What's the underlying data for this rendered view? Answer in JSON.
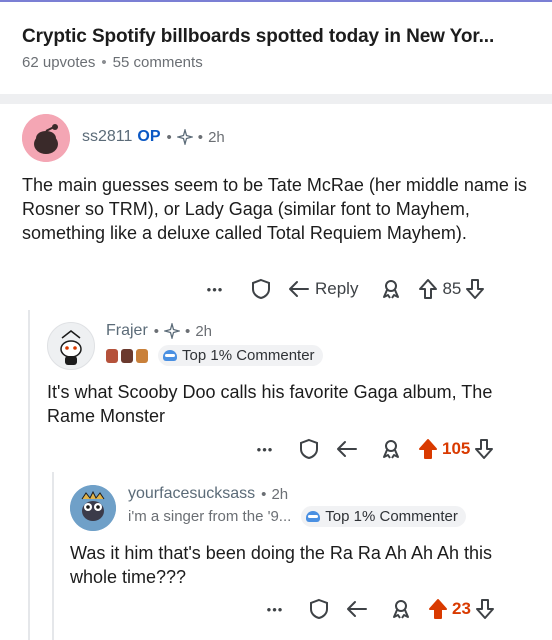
{
  "post": {
    "title": "Cryptic Spotify billboards spotted today in New Yor...",
    "upvotes": "62 upvotes",
    "comments": "55 comments",
    "separator": "•"
  },
  "comments": [
    {
      "username": "ss2811",
      "op_label": "OP",
      "separator": "•",
      "time": "2h",
      "body": "The main guesses seem to be Tate McRae (her middle name is Rosner so TRM), or Lady Gaga (similar font to Mayhem, something like a deluxe called Total Requiem Mayhem).",
      "more": "•••",
      "reply_label": "Reply",
      "score": "85",
      "avatar_color": "#f4a6b4"
    },
    {
      "username": "Frajer",
      "separator": "•",
      "time": "2h",
      "badge": "Top 1% Commenter",
      "body": "It's what Scooby Doo calls his favorite Gaga album, The Rame Monster",
      "more": "•••",
      "score": "105",
      "upvoted": true
    },
    {
      "username": "yourfacesucksass",
      "separator": "•",
      "time": "2h",
      "flair": "i'm a singer from the '9...",
      "badge": "Top 1% Commenter",
      "body": "Was it him that's been doing the Ra Ra Ah Ah Ah this whole time???",
      "more": "•••",
      "score": "23",
      "upvoted": true
    }
  ],
  "colors": {
    "accent_upvote": "#d93a00",
    "op_blue": "#0b58c4",
    "badge_bg": "#f1f2f4"
  }
}
